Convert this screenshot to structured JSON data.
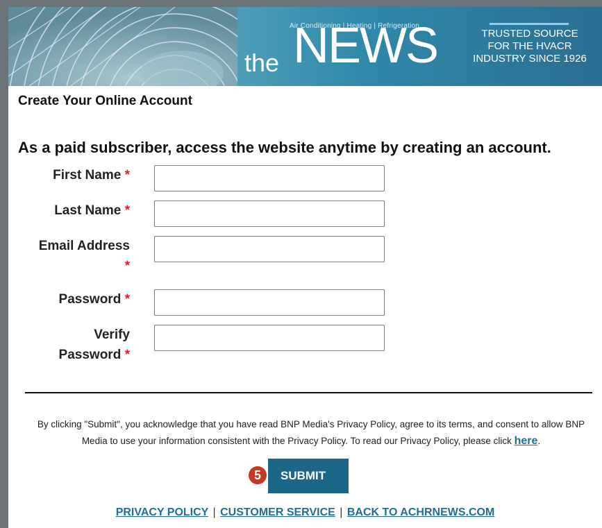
{
  "banner": {
    "tagline": "Air Conditioning | Heating | Refrigeration",
    "brand_prefix": "the",
    "brand_name": "NEWS",
    "trusted_line1": "TRUSTED SOURCE",
    "trusted_line2": "FOR THE HVACR",
    "trusted_line3": "INDUSTRY SINCE 1926"
  },
  "page": {
    "title": "Create Your Online Account",
    "subtitle": "As a paid subscriber, access the website anytime by creating an account."
  },
  "form": {
    "required_marker": "*",
    "first_name": {
      "label": "First Name",
      "value": ""
    },
    "last_name": {
      "label": "Last Name",
      "value": ""
    },
    "email": {
      "label": "Email Address",
      "value": ""
    },
    "password": {
      "label": "Password",
      "value": ""
    },
    "verify_line1": "Verify",
    "verify_line2": "Password"
  },
  "notice": {
    "text": "By clicking \"Submit\", you acknowledge that you have read BNP Media's Privacy Policy, agree to its terms, and consent to allow BNP Media to use your information consistent with the Privacy Policy. To read our Privacy Policy, please click",
    "link": "here",
    "end": "."
  },
  "submit": {
    "step": "5",
    "label": "SUBMIT"
  },
  "footer": {
    "privacy": "PRIVACY POLICY",
    "customer_service": "CUSTOMER SERVICE",
    "back": "BACK TO ACHRNEWS.COM",
    "separator": "|"
  },
  "colors": {
    "accent": "#1c6687",
    "required": "#e02020",
    "badge": "#c4391f"
  }
}
